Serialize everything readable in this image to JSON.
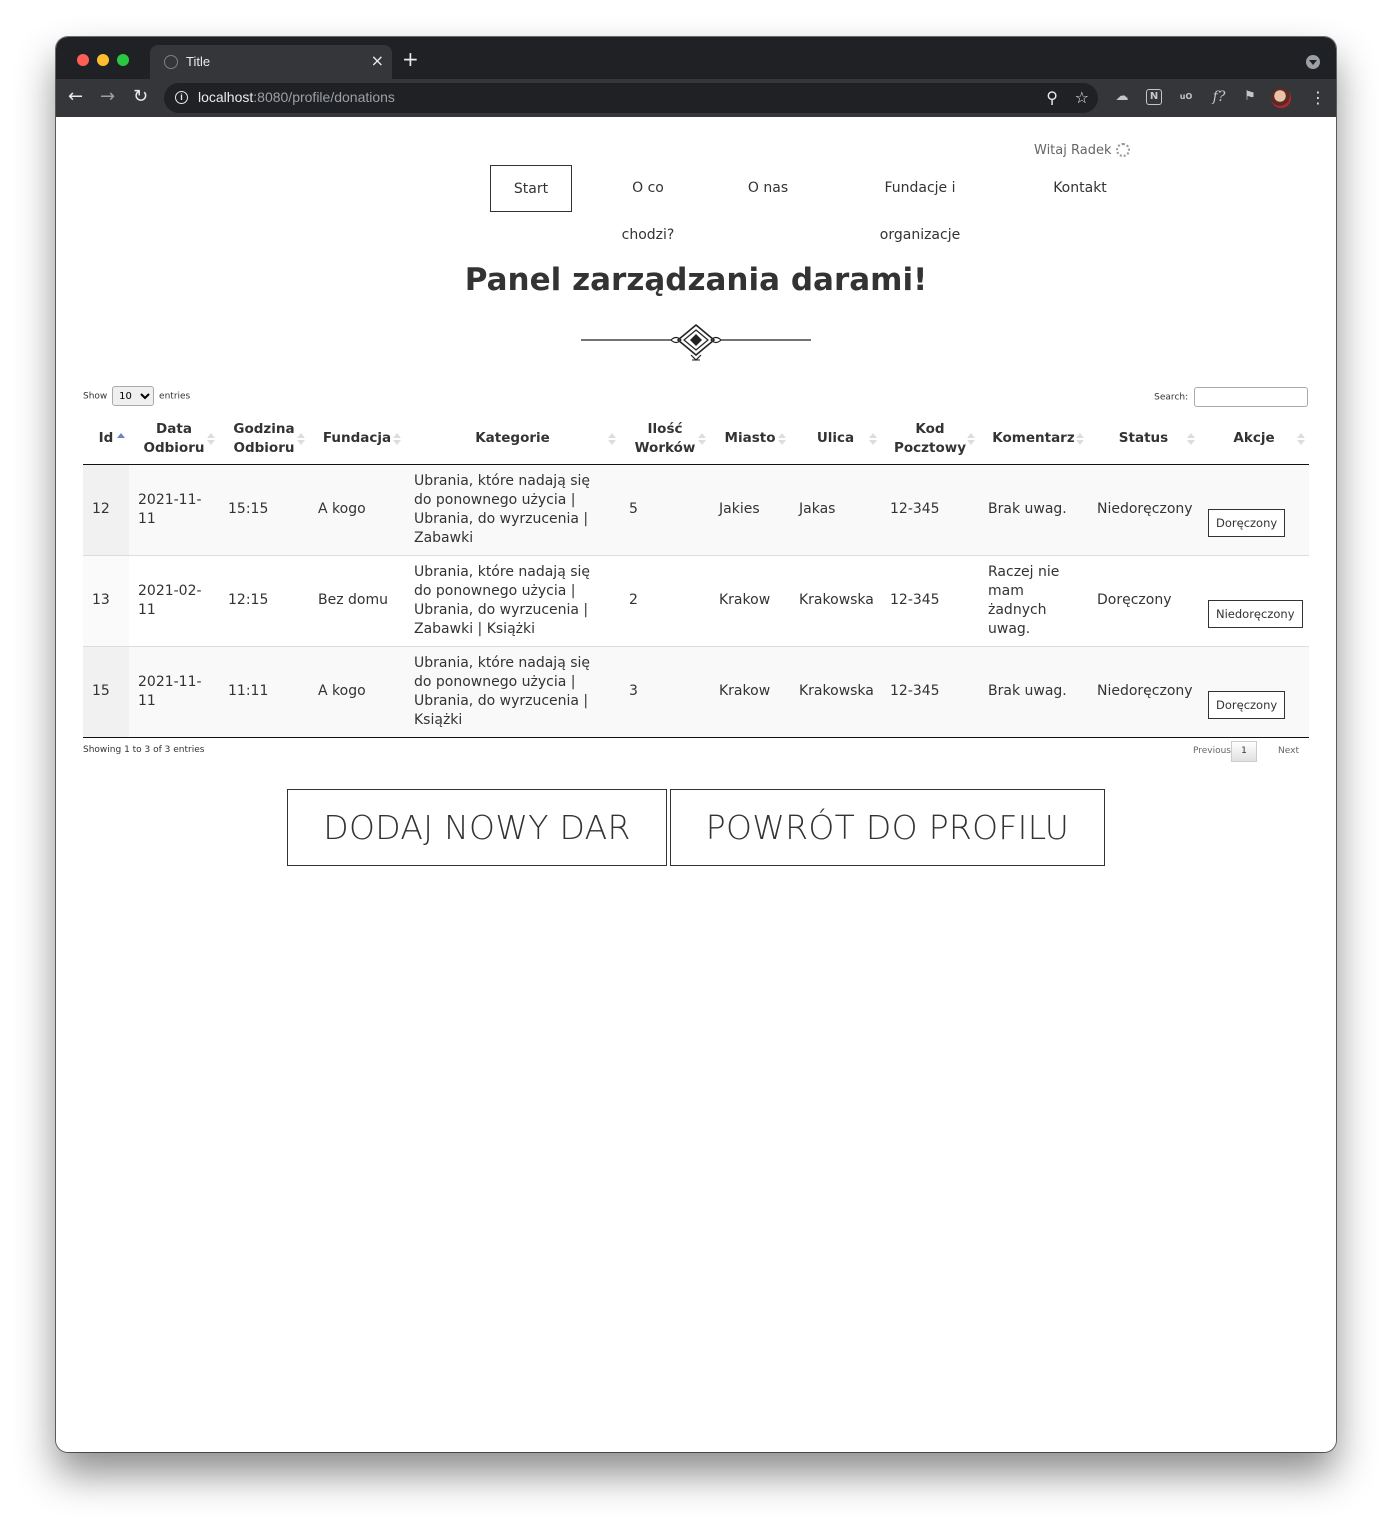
{
  "browser": {
    "tab_title": "Title",
    "tab_close": "×",
    "new_tab": "+",
    "url_host": "localhost",
    "url_rest": ":8080/profile/donations",
    "ext_notion": "N",
    "ext_ublock": "uO",
    "ext_formula": "f?",
    "menu": "⋮"
  },
  "header": {
    "greeting": "Witaj Radek",
    "nav": [
      "Start",
      "O co chodzi?",
      "O nas",
      "Fundacje i organizacje",
      "Kontakt"
    ]
  },
  "page_title": "Panel zarządzania darami!",
  "table_controls": {
    "show_label": "Show",
    "entries_label": "entries",
    "page_length": "10",
    "search_label": "Search:",
    "search_value": ""
  },
  "table": {
    "columns": [
      "Id",
      "Data Odbioru",
      "Godzina Odbioru",
      "Fundacja",
      "Kategorie",
      "Ilość Worków",
      "Miasto",
      "Ulica",
      "Kod Pocztowy",
      "Komentarz",
      "Status",
      "Akcje"
    ],
    "rows": [
      {
        "id": "12",
        "date": "2021-11-11",
        "time": "15:15",
        "foundation": "A kogo",
        "categories": "Ubrania, które nadają się do ponownego użycia | Ubrania, do wyrzucenia | Zabawki",
        "bags": "5",
        "city": "Jakies",
        "street": "Jakas",
        "zip": "12-345",
        "comment": "Brak uwag.",
        "status": "Niedoręczony",
        "action": "Doręczony"
      },
      {
        "id": "13",
        "date": "2021-02-11",
        "time": "12:15",
        "foundation": "Bez domu",
        "categories": "Ubrania, które nadają się do ponownego użycia | Ubrania, do wyrzucenia | Zabawki | Książki",
        "bags": "2",
        "city": "Krakow",
        "street": "Krakowska",
        "zip": "12-345",
        "comment": "Raczej nie mam żadnych uwag.",
        "status": "Doręczony",
        "action": "Niedoręczony"
      },
      {
        "id": "15",
        "date": "2021-11-11",
        "time": "11:11",
        "foundation": "A kogo",
        "categories": "Ubrania, które nadają się do ponownego użycia | Ubrania, do wyrzucenia | Książki",
        "bags": "3",
        "city": "Krakow",
        "street": "Krakowska",
        "zip": "12-345",
        "comment": "Brak uwag.",
        "status": "Niedoręczony",
        "action": "Doręczony"
      }
    ]
  },
  "table_footer": {
    "info": "Showing 1 to 3 of 3 entries",
    "previous": "Previous",
    "current_page": "1",
    "next": "Next"
  },
  "buttons": {
    "add": "DODAJ NOWY DAR",
    "back": "POWRÓT DO PROFILU"
  }
}
